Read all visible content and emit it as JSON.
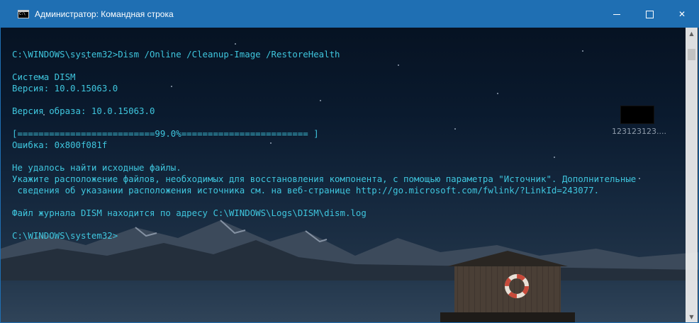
{
  "window": {
    "title": "Администратор: Командная строка",
    "icon": "cmd-icon",
    "accent_color": "#1f6fb3",
    "controls": {
      "minimize_icon": "minimize-icon",
      "maximize_icon": "maximize-icon",
      "close_icon": "close-icon",
      "close_glyph": "✕"
    }
  },
  "console": {
    "text_color": "#3fc6de",
    "lines": [
      "C:\\WINDOWS\\system32>Dism /Online /Cleanup-Image /RestoreHealth",
      "",
      "Система DISM",
      "Версия: 10.0.15063.0",
      "",
      "Версия образа: 10.0.15063.0",
      "",
      "[==========================99.0%======================== ]",
      "Ошибка: 0x800f081f",
      "",
      "Не удалось найти исходные файлы.",
      "Укажите расположение файлов, необходимых для восстановления компонента, с помощью параметра \"Источник\". Дополнительные",
      " сведения об указании расположения источника см. на веб-странице http://go.microsoft.com/fwlink/?LinkId=243077.",
      "",
      "Файл журнала DISM находится по адресу C:\\WINDOWS\\Logs\\DISM\\dism.log",
      "",
      "C:\\WINDOWS\\system32>"
    ]
  },
  "desktop": {
    "icon_label": "123123123...."
  },
  "scrollbar": {
    "up_glyph": "▲",
    "down_glyph": "▼"
  }
}
